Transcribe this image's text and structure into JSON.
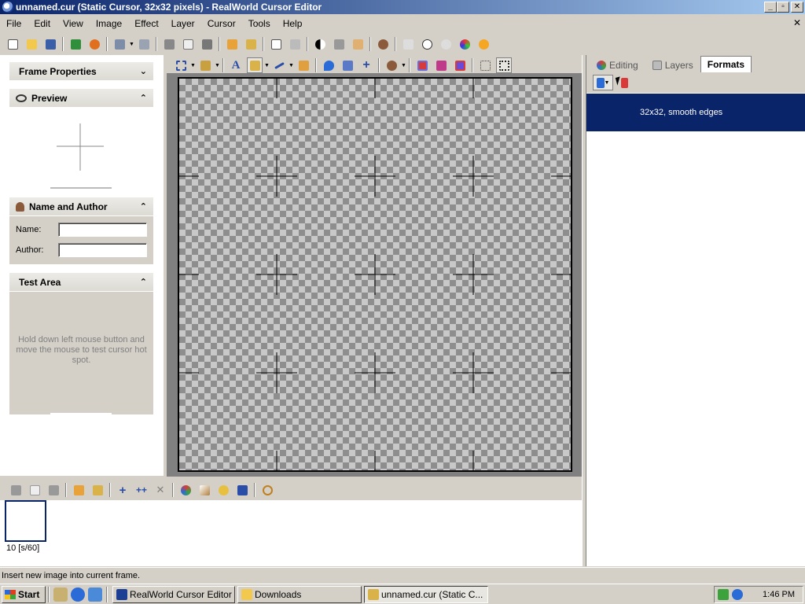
{
  "window": {
    "title": "unnamed.cur (Static Cursor, 32x32 pixels) - RealWorld Cursor Editor",
    "minimize": "_",
    "maximize": "▫",
    "close": "✕"
  },
  "menu": [
    "File",
    "Edit",
    "View",
    "Image",
    "Effect",
    "Layer",
    "Cursor",
    "Tools",
    "Help"
  ],
  "mdi_close": "✕",
  "left_panel": {
    "frame_properties": {
      "title": "Frame Properties",
      "chevron": "⌄"
    },
    "preview": {
      "title": "Preview",
      "chevron": "⌃"
    },
    "name_author": {
      "title": "Name and Author",
      "chevron": "⌃",
      "name_label": "Name:",
      "name_value": "",
      "author_label": "Author:",
      "author_value": ""
    },
    "test_area": {
      "title": "Test Area",
      "chevron": "⌃",
      "hint": "Hold down left mouse button and move the mouse to test cursor hot spot."
    }
  },
  "right_panel": {
    "tabs": [
      {
        "label": "Editing",
        "icon": "editing-icon",
        "active": false
      },
      {
        "label": "Layers",
        "icon": "layers-icon",
        "active": false
      },
      {
        "label": "Formats",
        "icon": "",
        "active": true
      }
    ],
    "formats": [
      {
        "label": "32x32, smooth edges",
        "selected": true
      }
    ]
  },
  "frames": {
    "items": [
      {
        "label": "10 [s/60]"
      }
    ]
  },
  "status": {
    "text": "Insert new image into current frame."
  },
  "taskbar": {
    "start": "Start",
    "tasks": [
      {
        "label": "RealWorld Cursor Editor -...",
        "pressed": false
      },
      {
        "label": "Downloads",
        "pressed": false
      },
      {
        "label": "unnamed.cur (Static C...",
        "pressed": true
      }
    ],
    "clock": "1:46 PM"
  },
  "colors": {
    "title_start": "#0a246a",
    "title_end": "#a6caf0",
    "selection": "#0a246a",
    "face": "#d4d0c8"
  }
}
